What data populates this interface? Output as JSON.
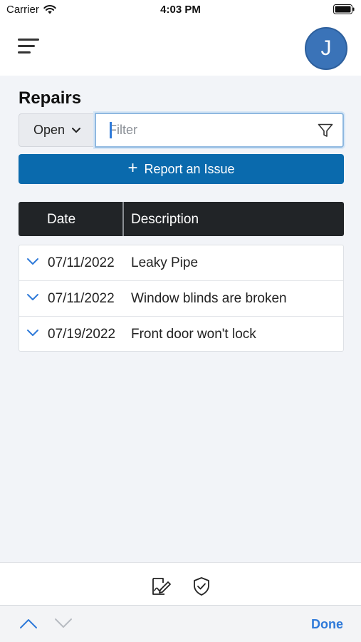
{
  "status_bar": {
    "carrier": "Carrier",
    "time": "4:03 PM"
  },
  "header": {
    "avatar_initial": "J"
  },
  "page": {
    "title": "Repairs"
  },
  "controls": {
    "status_selected": "Open",
    "filter_placeholder": "Filter",
    "report_button_label": "Report an Issue"
  },
  "table": {
    "columns": [
      "Date",
      "Description"
    ],
    "rows": [
      {
        "date": "07/11/2022",
        "description": "Leaky Pipe"
      },
      {
        "date": "07/11/2022",
        "description": "Window blinds are broken"
      },
      {
        "date": "07/19/2022",
        "description": "Front door won't lock"
      }
    ]
  },
  "toolbar": {
    "icons": [
      "sign-document-icon",
      "shield-check-icon"
    ]
  },
  "keyboard_bar": {
    "done_label": "Done"
  },
  "colors": {
    "accent": "#0a6aad",
    "header_bg": "#212427",
    "link": "#2f7ad9",
    "avatar": "#3a73b8"
  }
}
